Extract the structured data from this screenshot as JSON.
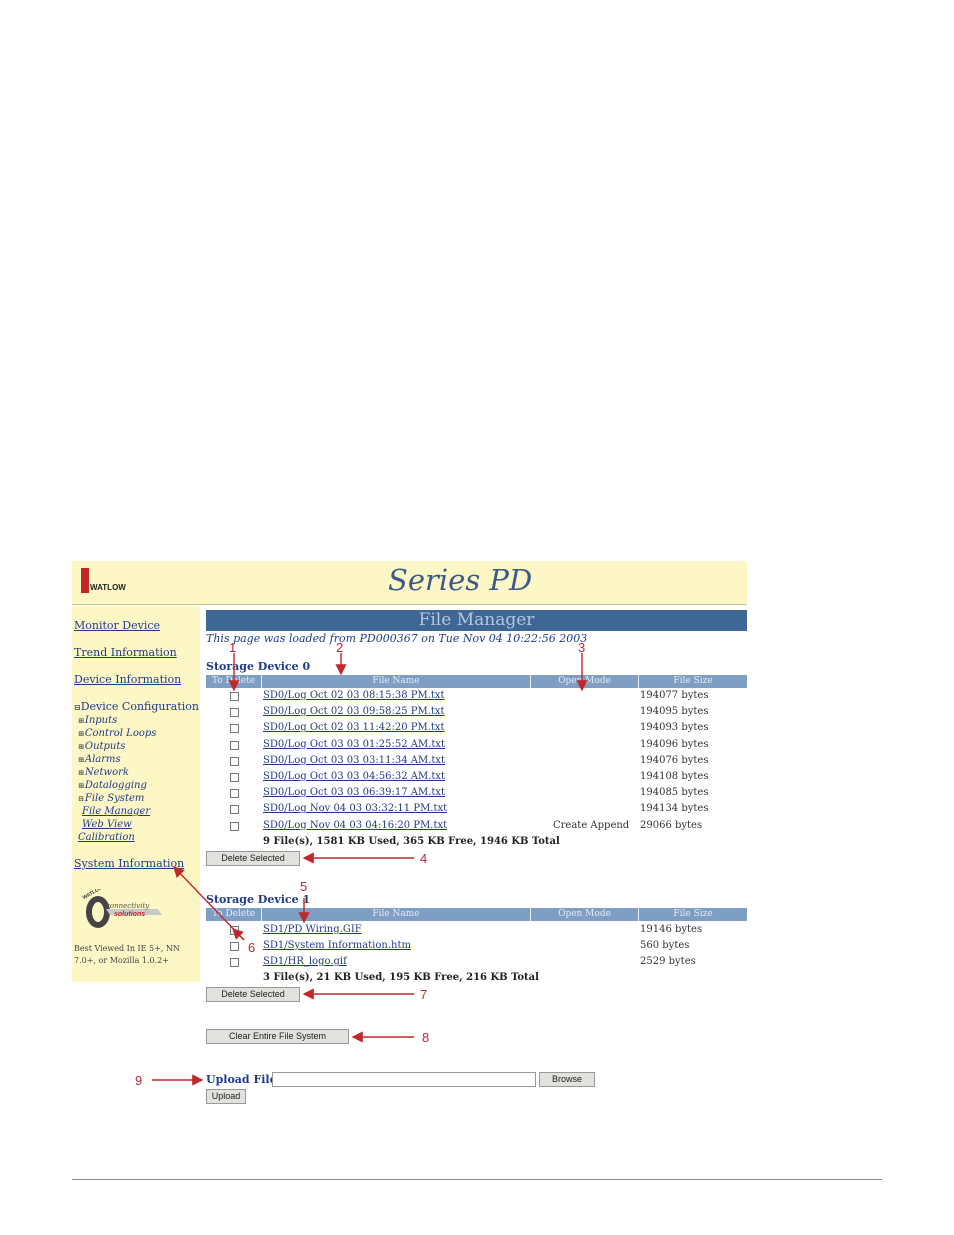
{
  "header": {
    "logo_text": "WATLOW",
    "title": "Series PD"
  },
  "sidebar": {
    "items": [
      {
        "label": "Monitor Device"
      },
      {
        "label": "Trend Information"
      },
      {
        "label": "Device Information"
      },
      {
        "label": "Device Configuration"
      },
      {
        "label": "System Information"
      }
    ],
    "device_config_toggle": "⊟",
    "sub_items": [
      {
        "prefix": "⊞",
        "label": "Inputs"
      },
      {
        "prefix": "⊞",
        "label": "Control Loops"
      },
      {
        "prefix": "⊞",
        "label": "Outputs"
      },
      {
        "prefix": "⊞",
        "label": "Alarms"
      },
      {
        "prefix": "⊞",
        "label": "Network"
      },
      {
        "prefix": "⊞",
        "label": "Datalogging"
      },
      {
        "prefix": "⊟",
        "label": "File System"
      }
    ],
    "file_system_items": [
      {
        "label": "File Manager"
      },
      {
        "label": "Web View"
      }
    ],
    "calibration": "Calibration",
    "logo": {
      "brand": "WATLOW",
      "line1": "connectivity",
      "line2": "solutions"
    },
    "best_viewed": "Best Viewed In IE 5+, NN 7.0+, or Mozilla 1.0.2+"
  },
  "main": {
    "title": "File Manager",
    "loaded_text": "This page was loaded from PD000367 on Tue Nov 04 10:22:56 2003",
    "columns": [
      "To Delete",
      "File Name",
      "Open Mode",
      "File Size"
    ],
    "storage0": {
      "label": "Storage Device 0",
      "files": [
        {
          "name": "SD0/Log Oct 02 03 08:15:38 PM.txt",
          "mode": "",
          "size": "194077 bytes"
        },
        {
          "name": "SD0/Log Oct 02 03 09:58:25 PM.txt",
          "mode": "",
          "size": "194095 bytes"
        },
        {
          "name": "SD0/Log Oct 02 03 11:42:20 PM.txt",
          "mode": "",
          "size": "194093 bytes"
        },
        {
          "name": "SD0/Log Oct 03 03 01:25:52 AM.txt",
          "mode": "",
          "size": "194096 bytes"
        },
        {
          "name": "SD0/Log Oct 03 03 03:11:34 AM.txt",
          "mode": "",
          "size": "194076 bytes"
        },
        {
          "name": "SD0/Log Oct 03 03 04:56:32 AM.txt",
          "mode": "",
          "size": "194108 bytes"
        },
        {
          "name": "SD0/Log Oct 03 03 06:39:17 AM.txt",
          "mode": "",
          "size": "194085 bytes"
        },
        {
          "name": "SD0/Log Nov 04 03 03:32:11 PM.txt",
          "mode": "",
          "size": "194134 bytes"
        },
        {
          "name": "SD0/Log Nov 04 03 04:16:20 PM.txt",
          "mode": "Create Append",
          "size": "29066 bytes"
        }
      ],
      "summary": "9 File(s), 1581 KB Used, 365 KB Free, 1946 KB Total",
      "delete_button": "Delete Selected"
    },
    "storage1": {
      "label": "Storage Device 1",
      "files": [
        {
          "name": "SD1/PD Wiring.GIF",
          "mode": "",
          "size": "19146 bytes"
        },
        {
          "name": "SD1/System Information.htm",
          "mode": "",
          "size": "560 bytes"
        },
        {
          "name": "SD1/HR_logo.gif",
          "mode": "",
          "size": "2529 bytes"
        }
      ],
      "summary": "3 File(s), 21 KB Used, 195 KB Free, 216 KB Total",
      "delete_button": "Delete Selected"
    },
    "clear_button": "Clear Entire File System",
    "upload": {
      "label": "Upload File:",
      "value": "",
      "browse": "Browse",
      "button": "Upload"
    }
  },
  "callouts": [
    "1",
    "2",
    "3",
    "4",
    "5",
    "6",
    "7",
    "8",
    "9"
  ],
  "colors": {
    "accent": "#3f6795",
    "header_bg": "#fcf7c4",
    "callout": "#c0282c",
    "link": "#203a8a"
  }
}
